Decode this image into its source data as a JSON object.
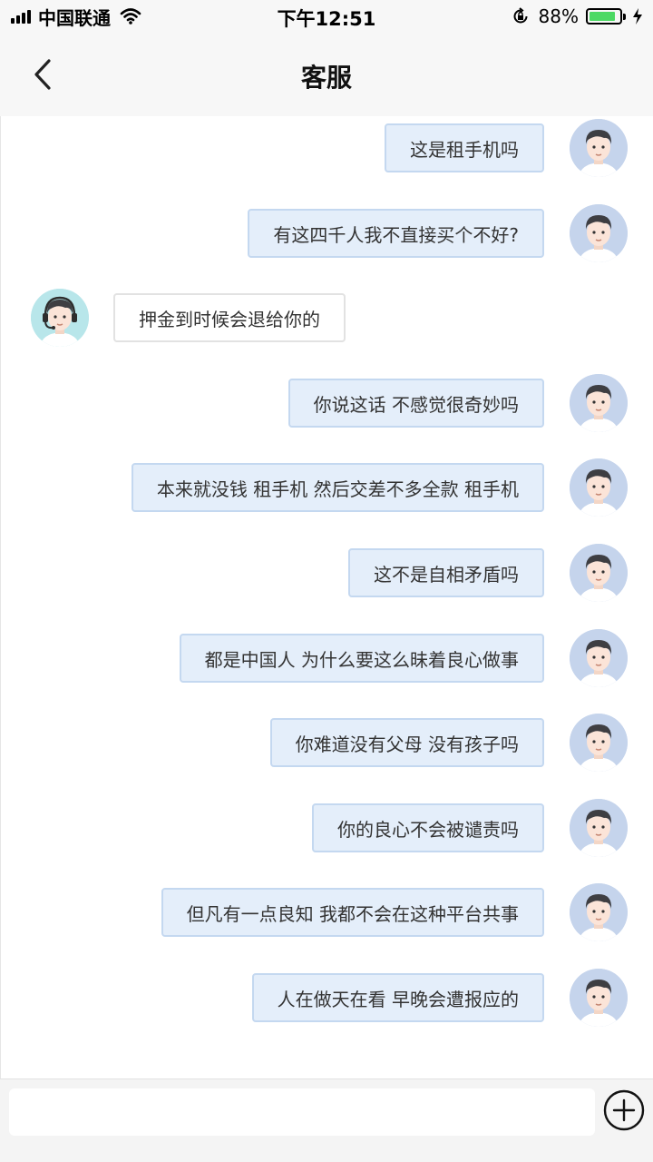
{
  "status_bar": {
    "carrier": "中国联通",
    "time": "下午12:51",
    "battery": "88%",
    "battery_level": 0.88,
    "icons": [
      "signal-icon",
      "wifi-icon",
      "rotation-lock-icon",
      "battery-icon",
      "charging-bolt-icon"
    ]
  },
  "nav": {
    "title": "客服",
    "back_icon": "chevron-left-icon"
  },
  "messages": [
    {
      "side": "right",
      "text": "这是租手机吗"
    },
    {
      "side": "right",
      "text": "有这四千人我不直接买个不好?"
    },
    {
      "side": "left",
      "text": "押金到时候会退给你的"
    },
    {
      "side": "right",
      "text": "你说这话 不感觉很奇妙吗"
    },
    {
      "side": "right",
      "text": "本来就没钱 租手机 然后交差不多全款 租手机"
    },
    {
      "side": "right",
      "text": "这不是自相矛盾吗"
    },
    {
      "side": "right",
      "text": "都是中国人 为什么要这么昧着良心做事"
    },
    {
      "side": "right",
      "text": "你难道没有父母 没有孩子吗"
    },
    {
      "side": "right",
      "text": "你的良心不会被谴责吗"
    },
    {
      "side": "right",
      "text": "但凡有一点良知 我都不会在这种平台共事"
    },
    {
      "side": "right",
      "text": "人在做天在看 早晚会遭报应的"
    }
  ],
  "input": {
    "value": "",
    "placeholder": "",
    "plus_icon": "plus-circle-icon"
  },
  "colors": {
    "sent_bubble": "#e4eefa",
    "sent_border": "#c4d8f0",
    "recv_bubble": "#ffffff",
    "battery_fill": "#4cd964"
  }
}
